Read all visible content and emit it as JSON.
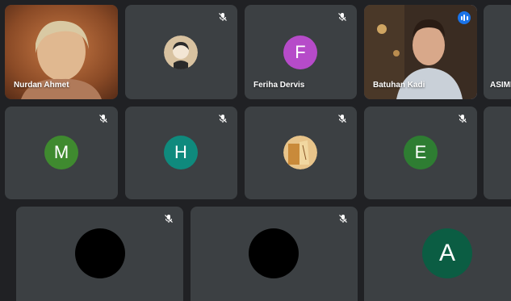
{
  "participants": [
    {
      "id": "p1",
      "name": "Nurdan Ahmet",
      "type": "video",
      "muted": false
    },
    {
      "id": "p2",
      "name": "",
      "type": "photo",
      "muted": true
    },
    {
      "id": "p3",
      "name": "Feriha Dervis",
      "type": "letter",
      "letter": "F",
      "color": "#b64bc9",
      "muted": true
    },
    {
      "id": "p4",
      "name": "Batuhan Kadi",
      "type": "video",
      "muted": false,
      "speaking": true
    },
    {
      "id": "p5",
      "name": "ASIMI",
      "type": "partial",
      "muted": false
    },
    {
      "id": "p6",
      "name": "",
      "type": "letter",
      "letter": "M",
      "color": "#3f8a2f",
      "muted": true
    },
    {
      "id": "p7",
      "name": "",
      "type": "letter",
      "letter": "H",
      "color": "#0f8a7d",
      "muted": true
    },
    {
      "id": "p8",
      "name": "",
      "type": "photo",
      "muted": true
    },
    {
      "id": "p9",
      "name": "",
      "type": "letter",
      "letter": "E",
      "color": "#2e7d32",
      "muted": true
    },
    {
      "id": "p10",
      "name": "",
      "type": "blank",
      "muted": false
    },
    {
      "id": "p11",
      "name": "",
      "type": "black",
      "muted": true
    },
    {
      "id": "p12",
      "name": "",
      "type": "black",
      "muted": true
    },
    {
      "id": "p13",
      "name": "",
      "type": "letter",
      "letter": "A",
      "color": "#0b5d43",
      "muted": false
    }
  ],
  "colors": {
    "background": "#202124",
    "tile": "#3c4043",
    "active_outline": "#8ab4f8",
    "speaking": "#1a73e8"
  }
}
